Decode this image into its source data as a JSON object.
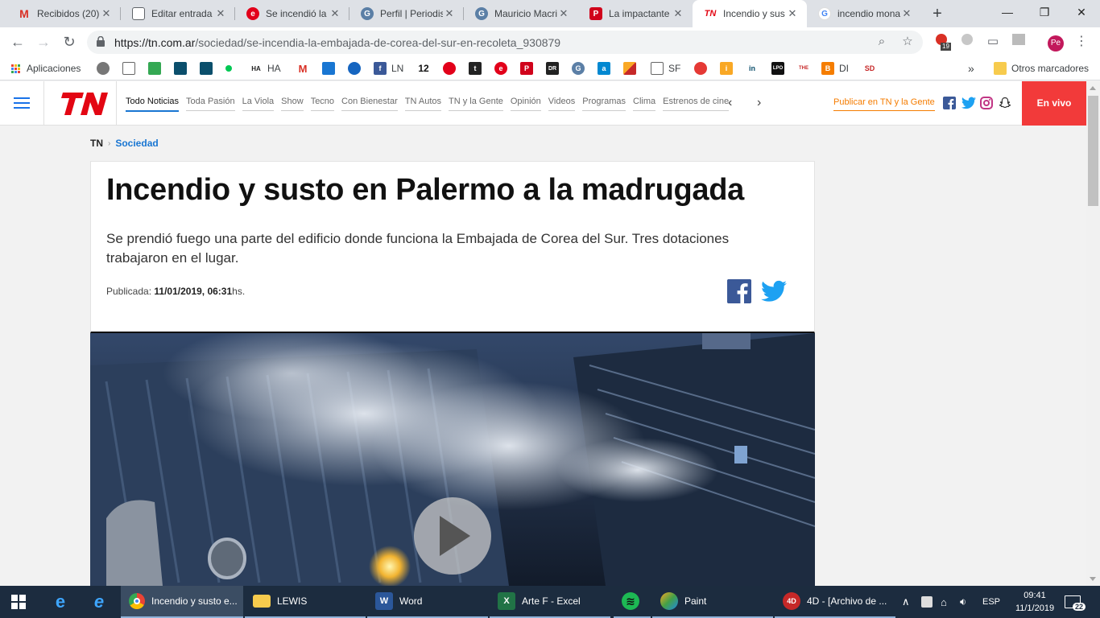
{
  "browser": {
    "tabs": [
      {
        "title": "Recibidos (20)",
        "icon": "gmail-icon",
        "color": "#d93025",
        "glyph": "M"
      },
      {
        "title": "Editar entrada",
        "icon": "document-icon",
        "color": "#5f6368",
        "glyph": ""
      },
      {
        "title": "Se incendió la",
        "icon": "clarin-icon",
        "color": "#e2001a",
        "glyph": "e"
      },
      {
        "title": "Perfil | Periodis",
        "icon": "perfil-icon",
        "color": "#5b7fa6",
        "glyph": "G"
      },
      {
        "title": "Mauricio Macri",
        "icon": "perfil-icon",
        "color": "#5b7fa6",
        "glyph": "G"
      },
      {
        "title": "La impactante",
        "icon": "pagina12-icon",
        "color": "#d0021b",
        "glyph": "P"
      },
      {
        "title": "Incendio y sus",
        "icon": "tn-icon",
        "color": "#e30613",
        "glyph": "TN"
      },
      {
        "title": "incendio mona",
        "icon": "google-icon",
        "color": "#4285f4",
        "glyph": "G"
      }
    ],
    "url_host": "https://tn.com.ar",
    "url_path": "/sociedad/se-incendia-la-embajada-de-corea-del-sur-en-recoleta_930879",
    "ext_badge": "19",
    "profile_initials": "Pe"
  },
  "bookmarks": {
    "apps_label": "Aplicaciones",
    "items": [
      {
        "label": "HA",
        "color": "#222",
        "glyph": "HA"
      },
      {
        "label": "LN",
        "color": "#3b5998",
        "glyph": "f"
      },
      {
        "label": "SF",
        "color": "#888",
        "glyph": ""
      },
      {
        "label": "DI",
        "color": "#f57d00",
        "glyph": "B"
      }
    ],
    "other_label": "Otros marcadores"
  },
  "site": {
    "nav": [
      "Todo Noticias",
      "Toda Pasión",
      "La Viola",
      "Show",
      "Tecno",
      "Con Bienestar",
      "TN Autos",
      "TN y la Gente",
      "Opinión",
      "Videos",
      "Programas",
      "Clima",
      "Estrenos de cine"
    ],
    "publicar": "Publicar en TN y la Gente",
    "envivo": "En vivo"
  },
  "article": {
    "breadcrumb_home": "TN",
    "breadcrumb_section": "Sociedad",
    "title": "Incendio y susto en Palermo a la madrugada",
    "bajada": "Se prendió fuego una parte del edificio donde funciona la Embajada de Corea del Sur. Tres dotaciones trabajaron en el lugar.",
    "pub_label": "Publicada:",
    "pub_date": "11/01/2019, 06:31",
    "pub_suffix": "hs."
  },
  "taskbar": {
    "apps": [
      {
        "label": "Incendio y susto e...",
        "icon": "chrome-icon"
      },
      {
        "label": "LEWIS",
        "icon": "folder-icon"
      },
      {
        "label": "Word",
        "icon": "word-icon"
      },
      {
        "label": "Arte F - Excel",
        "icon": "excel-icon"
      },
      {
        "label": "",
        "icon": "spotify-icon"
      },
      {
        "label": "Paint",
        "icon": "paint-icon"
      },
      {
        "label": "4D - [Archivo de ...",
        "icon": "4d-icon"
      }
    ],
    "lang": "ESP",
    "time": "09:41",
    "date": "11/1/2019",
    "notif_count": "22"
  }
}
